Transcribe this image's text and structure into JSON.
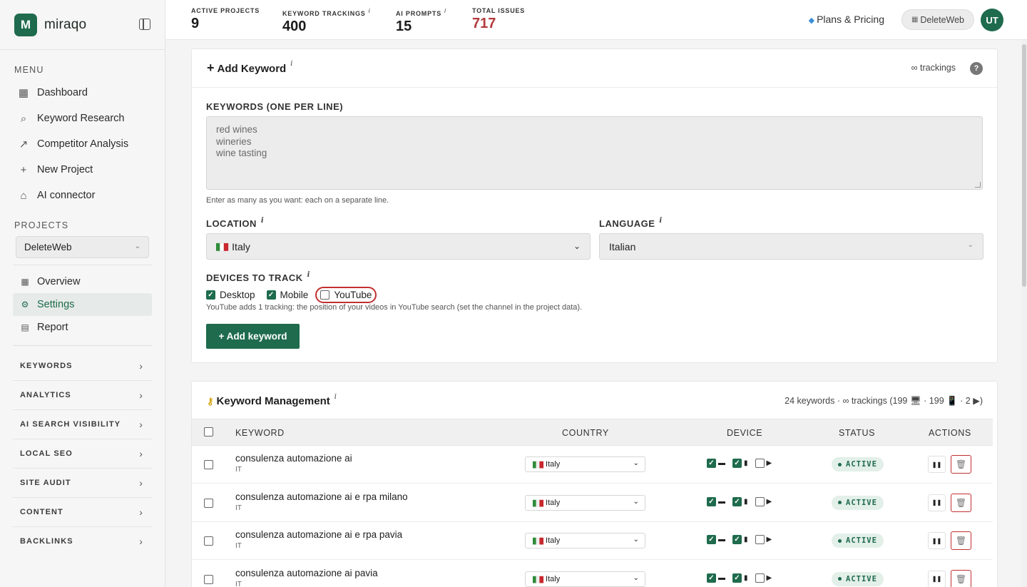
{
  "brand": {
    "logo_letter": "M",
    "name": "miraqo"
  },
  "sidebar": {
    "menu_title": "MENU",
    "menu": [
      {
        "label": "Dashboard",
        "icon": "grid-icon",
        "glyph": "▦"
      },
      {
        "label": "Keyword Research",
        "icon": "search-icon",
        "glyph": "⌕"
      },
      {
        "label": "Competitor Analysis",
        "icon": "chart-line-icon",
        "glyph": "↗"
      },
      {
        "label": "New Project",
        "icon": "plus-icon",
        "glyph": "+"
      },
      {
        "label": "AI connector",
        "icon": "robot-icon",
        "glyph": "⌂"
      }
    ],
    "projects_title": "PROJECTS",
    "project_selected": "DeleteWeb",
    "project_items": [
      {
        "label": "Overview",
        "icon": "grid-icon",
        "glyph": "▦"
      },
      {
        "label": "Settings",
        "icon": "gear-icon",
        "glyph": "⚙"
      },
      {
        "label": "Report",
        "icon": "document-icon",
        "glyph": "▤"
      }
    ],
    "groups": [
      "KEYWORDS",
      "ANALYTICS",
      "AI SEARCH VISIBILITY",
      "LOCAL SEO",
      "SITE AUDIT",
      "CONTENT",
      "BACKLINKS"
    ]
  },
  "topbar": {
    "stats": [
      {
        "label": "ACTIVE PROJECTS",
        "value": "9",
        "info": ""
      },
      {
        "label": "KEYWORD TRACKINGS",
        "value": "400",
        "info": "i"
      },
      {
        "label": "AI PROMPTS",
        "value": "15",
        "info": "i"
      },
      {
        "label": "TOTAL ISSUES",
        "value": "717",
        "info": ""
      }
    ],
    "plans_label": "Plans & Pricing",
    "project_chip": "DeleteWeb",
    "avatar_initials": "UT"
  },
  "add_keyword": {
    "title": "Add Keyword",
    "info": "i",
    "trackings": "∞ trackings",
    "help": "?",
    "keywords_label": "KEYWORDS (ONE PER LINE)",
    "keywords_lines": [
      "red wines",
      "wineries",
      "wine tasting"
    ],
    "keywords_help": "Enter as many as you want: each on a separate line.",
    "location_label": "LOCATION",
    "location_value": "Italy",
    "language_label": "LANGUAGE",
    "language_value": "Italian",
    "devices_label": "DEVICES TO TRACK",
    "devices": [
      {
        "label": "Desktop",
        "checked": true
      },
      {
        "label": "Mobile",
        "checked": true
      },
      {
        "label": "YouTube",
        "checked": false
      }
    ],
    "youtube_help": "YouTube adds 1 tracking: the position of your videos in YouTube search (set the channel in the project data).",
    "button_label": "+ Add keyword"
  },
  "management": {
    "title": "Keyword Management",
    "info": "i",
    "summary": "24 keywords · ∞ trackings (199 🖥 · 199 📱 · 2 ▶)",
    "columns": [
      "KEYWORD",
      "COUNTRY",
      "DEVICE",
      "STATUS",
      "ACTIONS"
    ],
    "rows": [
      {
        "keyword": "consulenza automazione ai",
        "code": "IT",
        "country": "Italy",
        "status": "ACTIVE"
      },
      {
        "keyword": "consulenza automazione ai e rpa milano",
        "code": "IT",
        "country": "Italy",
        "status": "ACTIVE"
      },
      {
        "keyword": "consulenza automazione ai e rpa pavia",
        "code": "IT",
        "country": "Italy",
        "status": "ACTIVE"
      },
      {
        "keyword": "consulenza automazione ai pavia",
        "code": "IT",
        "country": "Italy",
        "status": "ACTIVE"
      }
    ]
  },
  "colors": {
    "brand": "#1e6b4d",
    "issues": "#b23a3a",
    "highlight": "#c23030"
  }
}
